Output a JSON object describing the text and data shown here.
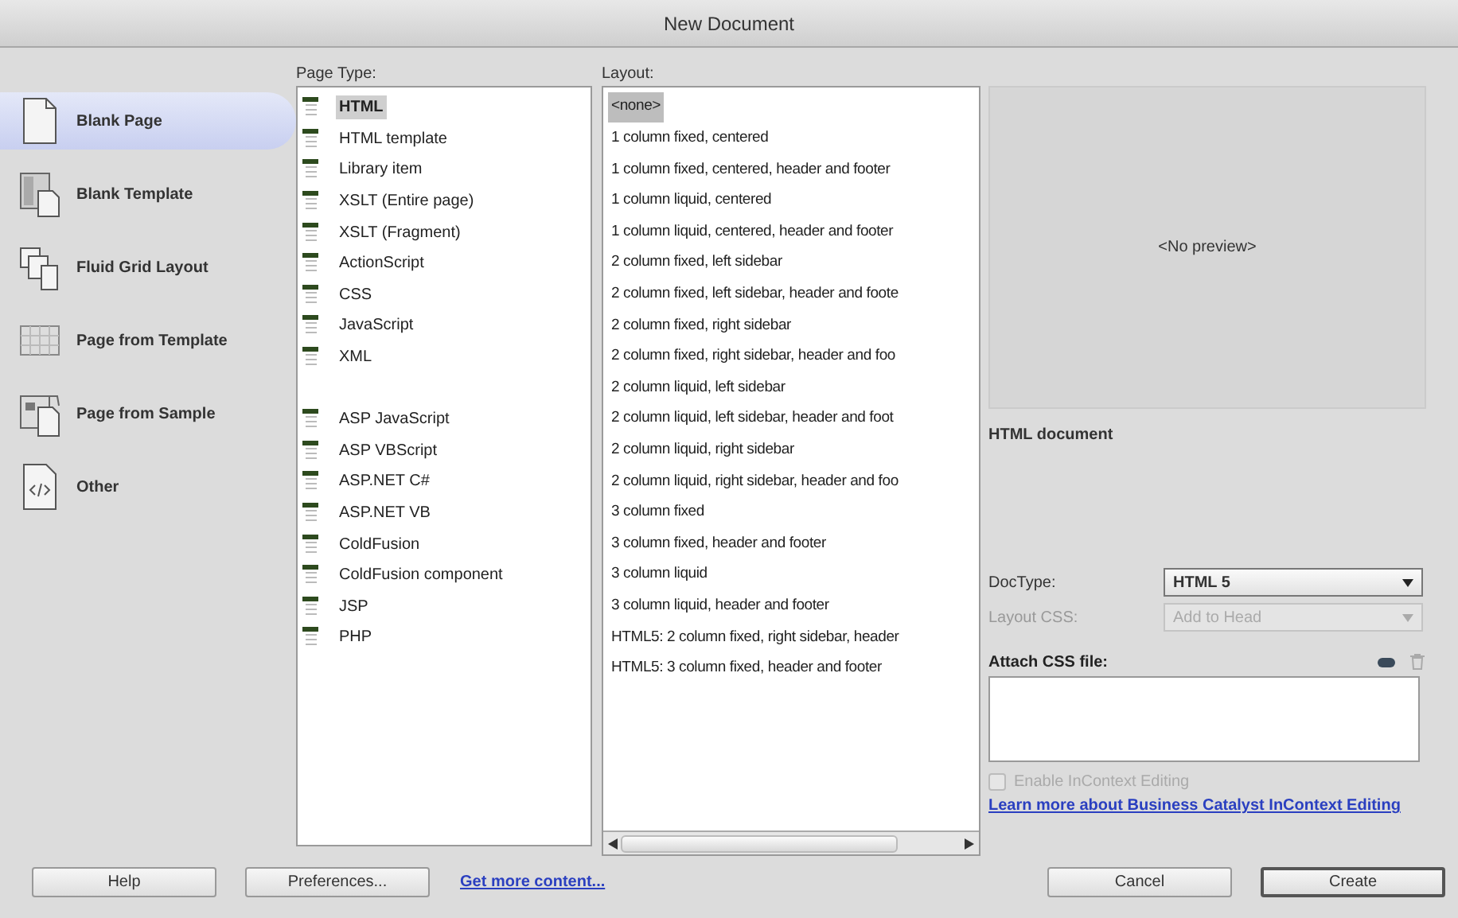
{
  "window": {
    "title": "New Document"
  },
  "categories": [
    {
      "label": "Blank Page",
      "kind": "page",
      "selected": true
    },
    {
      "label": "Blank Template",
      "kind": "template",
      "selected": false
    },
    {
      "label": "Fluid Grid Layout",
      "kind": "fluid",
      "selected": false
    },
    {
      "label": "Page from Template",
      "kind": "grid",
      "selected": false
    },
    {
      "label": "Page from Sample",
      "kind": "sample",
      "selected": false
    },
    {
      "label": "Other",
      "kind": "code",
      "selected": false
    }
  ],
  "page_type": {
    "label": "Page Type:",
    "groups": [
      [
        {
          "label": "HTML",
          "selected": true
        },
        {
          "label": "HTML template",
          "selected": false
        },
        {
          "label": "Library item",
          "selected": false
        },
        {
          "label": "XSLT (Entire page)",
          "selected": false
        },
        {
          "label": "XSLT (Fragment)",
          "selected": false
        },
        {
          "label": "ActionScript",
          "selected": false
        },
        {
          "label": "CSS",
          "selected": false
        },
        {
          "label": "JavaScript",
          "selected": false
        },
        {
          "label": "XML",
          "selected": false
        }
      ],
      [
        {
          "label": "ASP JavaScript",
          "selected": false
        },
        {
          "label": "ASP VBScript",
          "selected": false
        },
        {
          "label": "ASP.NET C#",
          "selected": false
        },
        {
          "label": "ASP.NET VB",
          "selected": false
        },
        {
          "label": "ColdFusion",
          "selected": false
        },
        {
          "label": "ColdFusion component",
          "selected": false
        },
        {
          "label": "JSP",
          "selected": false
        },
        {
          "label": "PHP",
          "selected": false
        }
      ]
    ]
  },
  "layout": {
    "label": "Layout:",
    "items": [
      {
        "label": "<none>",
        "selected": true
      },
      {
        "label": "1 column fixed, centered",
        "selected": false
      },
      {
        "label": "1 column fixed, centered, header and footer",
        "selected": false
      },
      {
        "label": "1 column liquid, centered",
        "selected": false
      },
      {
        "label": "1 column liquid, centered, header and footer",
        "selected": false
      },
      {
        "label": "2 column fixed, left sidebar",
        "selected": false
      },
      {
        "label": "2 column fixed, left sidebar, header and foote",
        "selected": false
      },
      {
        "label": "2 column fixed, right sidebar",
        "selected": false
      },
      {
        "label": "2 column fixed, right sidebar, header and foo",
        "selected": false
      },
      {
        "label": "2 column liquid, left sidebar",
        "selected": false
      },
      {
        "label": "2 column liquid, left sidebar, header and foot",
        "selected": false
      },
      {
        "label": "2 column liquid, right sidebar",
        "selected": false
      },
      {
        "label": "2 column liquid, right sidebar, header and foo",
        "selected": false
      },
      {
        "label": "3 column fixed",
        "selected": false
      },
      {
        "label": "3 column fixed, header and footer",
        "selected": false
      },
      {
        "label": "3 column liquid",
        "selected": false
      },
      {
        "label": "3 column liquid, header and footer",
        "selected": false
      },
      {
        "label": "HTML5: 2 column fixed, right sidebar, header",
        "selected": false
      },
      {
        "label": "HTML5: 3 column fixed, header and footer",
        "selected": false
      }
    ]
  },
  "preview": {
    "text": "<No preview>"
  },
  "description": "HTML document",
  "doctype": {
    "label": "DocType:",
    "value": "HTML 5",
    "disabled": false
  },
  "layout_css": {
    "label": "Layout CSS:",
    "value": "Add to Head",
    "disabled": true
  },
  "attach_css": {
    "label": "Attach CSS file:"
  },
  "incontext": {
    "label": "Enable InContext Editing",
    "checked": false,
    "disabled": true
  },
  "learn_more": "Learn more about Business Catalyst InContext Editing",
  "buttons_left": [
    {
      "label": "Help"
    },
    {
      "label": "Preferences..."
    }
  ],
  "more_link": "Get more content...",
  "buttons_right": [
    {
      "label": "Cancel",
      "default": false
    },
    {
      "label": "Create",
      "default": true
    }
  ]
}
